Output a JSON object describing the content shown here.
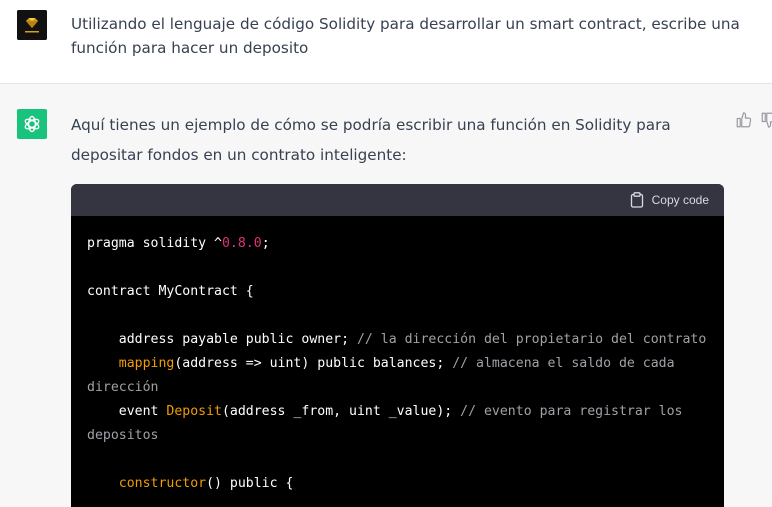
{
  "user_message": {
    "text": "Utilizando el lenguaje de código Solidity para desarrollar un smart contract, escribe una función para hacer un deposito"
  },
  "assistant_message": {
    "text": "Aquí tienes un ejemplo de cómo se podría escribir una función en Solidity para depositar fondos en un contrato inteligente:"
  },
  "code_block": {
    "copy_label": "Copy code",
    "lines": [
      [
        {
          "t": "pragma solidity ^",
          "c": ""
        },
        {
          "t": "0.8.0",
          "c": "num"
        },
        {
          "t": ";",
          "c": ""
        }
      ],
      [],
      [
        {
          "t": "contract MyContract {",
          "c": ""
        }
      ],
      [],
      [
        {
          "t": "    address payable public owner; ",
          "c": ""
        },
        {
          "t": "// la dirección del propietario del contrato",
          "c": "cm"
        }
      ],
      [
        {
          "t": "    ",
          "c": ""
        },
        {
          "t": "mapping",
          "c": "kw"
        },
        {
          "t": "(address => uint) public balances; ",
          "c": ""
        },
        {
          "t": "// almacena el saldo de cada dirección",
          "c": "cm"
        }
      ],
      [
        {
          "t": "    event ",
          "c": ""
        },
        {
          "t": "Deposit",
          "c": "kw"
        },
        {
          "t": "(address _from, uint _value); ",
          "c": ""
        },
        {
          "t": "// evento para registrar los depositos",
          "c": "cm"
        }
      ],
      [],
      [
        {
          "t": "    ",
          "c": ""
        },
        {
          "t": "constructor",
          "c": "kw"
        },
        {
          "t": "() public {",
          "c": ""
        }
      ]
    ]
  },
  "icons": {
    "user_avatar": "gold-diamond-logo",
    "assistant_avatar": "openai-logo-icon",
    "copy": "clipboard-icon",
    "thumbs_up": "thumbs-up-icon",
    "thumbs_down": "thumbs-down-icon"
  },
  "colors": {
    "assistant_bg": "#f7f7f8",
    "avatar_green": "#19c37d",
    "code_bg": "#000000",
    "code_header_bg": "#343541"
  }
}
